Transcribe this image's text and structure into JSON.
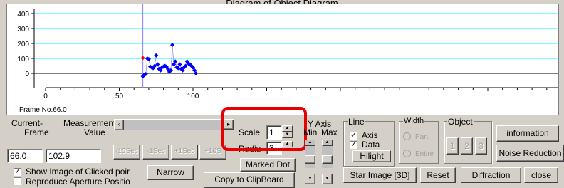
{
  "window": {
    "title": "Diagram of Object Diagram"
  },
  "chart_data": {
    "type": "scatter",
    "y_ticks": [
      "400",
      "300",
      "200",
      "100",
      "0"
    ],
    "x_ticks": [
      "0",
      "50",
      "100"
    ],
    "xlim": [
      0,
      340
    ],
    "ylim": [
      -20,
      440
    ],
    "cursor_x": 66,
    "highlight_point": {
      "x": 66,
      "y": 102.9
    },
    "points": [
      [
        66,
        -20
      ],
      [
        67,
        -10
      ],
      [
        68,
        -5
      ],
      [
        69,
        100
      ],
      [
        70,
        95
      ],
      [
        71,
        45
      ],
      [
        72,
        40
      ],
      [
        73,
        35
      ],
      [
        74,
        50
      ],
      [
        75,
        120
      ],
      [
        76,
        60
      ],
      [
        77,
        30
      ],
      [
        78,
        20
      ],
      [
        79,
        40
      ],
      [
        80,
        45
      ],
      [
        81,
        50
      ],
      [
        82,
        45
      ],
      [
        83,
        30
      ],
      [
        84,
        10
      ],
      [
        85,
        20
      ],
      [
        86,
        190
      ],
      [
        87,
        60
      ],
      [
        88,
        80
      ],
      [
        89,
        40
      ],
      [
        90,
        35
      ],
      [
        91,
        60
      ],
      [
        92,
        30
      ],
      [
        93,
        20
      ],
      [
        94,
        40
      ],
      [
        95,
        50
      ],
      [
        96,
        80
      ],
      [
        97,
        65
      ],
      [
        98,
        60
      ],
      [
        99,
        50
      ],
      [
        100,
        40
      ],
      [
        101,
        20
      ],
      [
        102,
        0
      ]
    ],
    "colors": {
      "gridline": "#00ffff",
      "points": "#0000ff",
      "highlight": "#ff0000",
      "cursor": "#8080ff"
    }
  },
  "frame_label": "Frame No.66.0",
  "current": {
    "label": "Current-",
    "frame_label": "Frame",
    "frame_value": "66.0"
  },
  "measurement": {
    "label": "Measurement-",
    "value_label": "Value",
    "value": "102.9"
  },
  "step_buttons": [
    "-10Sec",
    "-1Sec",
    "+1Sec",
    "+10S"
  ],
  "checkboxes": {
    "show_image": "Show Image of Clicked poir",
    "reproduce": "Reproduce Aperture Positio"
  },
  "narrow_button": "Narrow",
  "copy_button": "Copy to ClipBoard",
  "scale": {
    "label": "Scale",
    "value": "1"
  },
  "radius": {
    "label": "Radiu",
    "value": "3"
  },
  "marked_dot_button": "Marked Dot",
  "y_axis": {
    "label": "Y Axis",
    "min": "Min",
    "max": "Max"
  },
  "line_group": {
    "label": "Line",
    "axis": "Axis",
    "data": "Data",
    "hilight": "Hilight"
  },
  "width_group": {
    "label": "Width",
    "part": "Part",
    "entire": "Entire"
  },
  "object_group": {
    "label": "Object",
    "buttons": [
      "1",
      "2",
      "3"
    ]
  },
  "right_buttons": {
    "information": "information",
    "noise": "Noise Reduction"
  },
  "bottom_buttons": {
    "star": "Star Image [3D]",
    "reset": "Reset",
    "diffraction": "Diffraction",
    "close": "close"
  }
}
